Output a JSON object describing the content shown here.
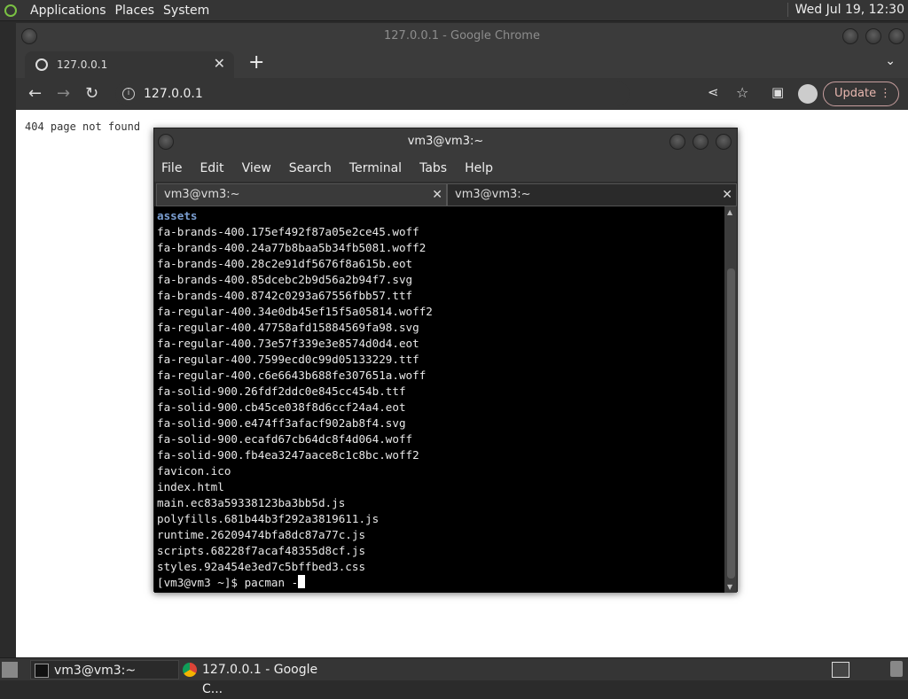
{
  "top_panel": {
    "menus": [
      "Applications",
      "Places",
      "System"
    ],
    "clock": "Wed Jul 19, 12:30"
  },
  "chrome": {
    "window_title": "127.0.0.1 - Google Chrome",
    "tab_title": "127.0.0.1",
    "address": "127.0.0.1",
    "update_label": "Update",
    "page_text": "404 page not found"
  },
  "terminal": {
    "title": "vm3@vm3:~",
    "menu": [
      "File",
      "Edit",
      "View",
      "Search",
      "Terminal",
      "Tabs",
      "Help"
    ],
    "tabs": [
      "vm3@vm3:~",
      "vm3@vm3:~"
    ],
    "dir_line": "assets",
    "lines": [
      "fa-brands-400.175ef492f87a05e2ce45.woff",
      "fa-brands-400.24a77b8baa5b34fb5081.woff2",
      "fa-brands-400.28c2e91df5676f8a615b.eot",
      "fa-brands-400.85dcebc2b9d56a2b94f7.svg",
      "fa-brands-400.8742c0293a67556fbb57.ttf",
      "fa-regular-400.34e0db45ef15f5a05814.woff2",
      "fa-regular-400.47758afd15884569fa98.svg",
      "fa-regular-400.73e57f339e3e8574d0d4.eot",
      "fa-regular-400.7599ecd0c99d05133229.ttf",
      "fa-regular-400.c6e6643b688fe307651a.woff",
      "fa-solid-900.26fdf2ddc0e845cc454b.ttf",
      "fa-solid-900.cb45ce038f8d6ccf24a4.eot",
      "fa-solid-900.e474ff3afacf902ab8f4.svg",
      "fa-solid-900.ecafd67cb64dc8f4d064.woff",
      "fa-solid-900.fb4ea3247aace8c1c8bc.woff2",
      "favicon.ico",
      "index.html",
      "main.ec83a59338123ba3bb5d.js",
      "polyfills.681b44b3f292a3819611.js",
      "runtime.26209474bfa8dc87a77c.js",
      "scripts.68228f7acaf48355d8cf.js",
      "styles.92a454e3ed7c5bffbed3.css"
    ],
    "prompt": "[vm3@vm3 ~]$ ",
    "command": "pacman -"
  },
  "taskbar": {
    "items": [
      "vm3@vm3:~",
      "127.0.0.1 - Google C..."
    ]
  }
}
